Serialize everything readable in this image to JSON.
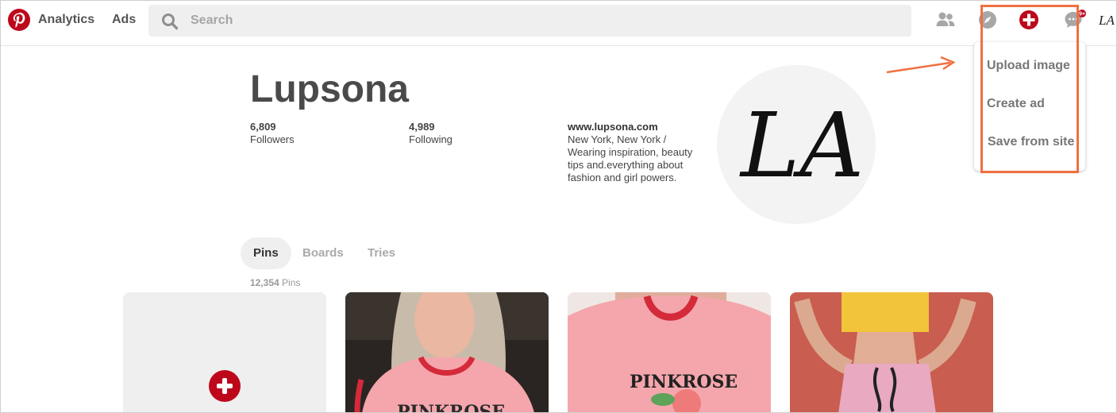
{
  "header": {
    "nav": [
      "Analytics",
      "Ads"
    ],
    "search_placeholder": "Search",
    "notification_badge": "9+",
    "user_initials": "LA"
  },
  "dropdown": {
    "items": [
      "Upload image",
      "Create ad",
      "Save from site"
    ]
  },
  "profile": {
    "name": "Lupsona",
    "followers_count": "6,809",
    "followers_label": "Followers",
    "following_count": "4,989",
    "following_label": "Following",
    "website": "www.lupsona.com",
    "bio": "New York, New York / Wearing inspiration, beauty tips and.everything about fashion and girl powers.",
    "avatar_text": "LA"
  },
  "tabs": [
    "Pins",
    "Boards",
    "Tries"
  ],
  "pins": {
    "count": "12,354",
    "count_label": "Pins",
    "shirt_text": "PINKROSE"
  },
  "colors": {
    "brand_red": "#bd081c",
    "annotation": "#f07040",
    "shirt_pink": "#f4a6ac",
    "shirt_trim": "#d42a3a"
  },
  "icons": [
    "pinterest-logo-icon",
    "search-icon",
    "people-icon",
    "compass-icon",
    "plus-icon",
    "chat-icon"
  ]
}
